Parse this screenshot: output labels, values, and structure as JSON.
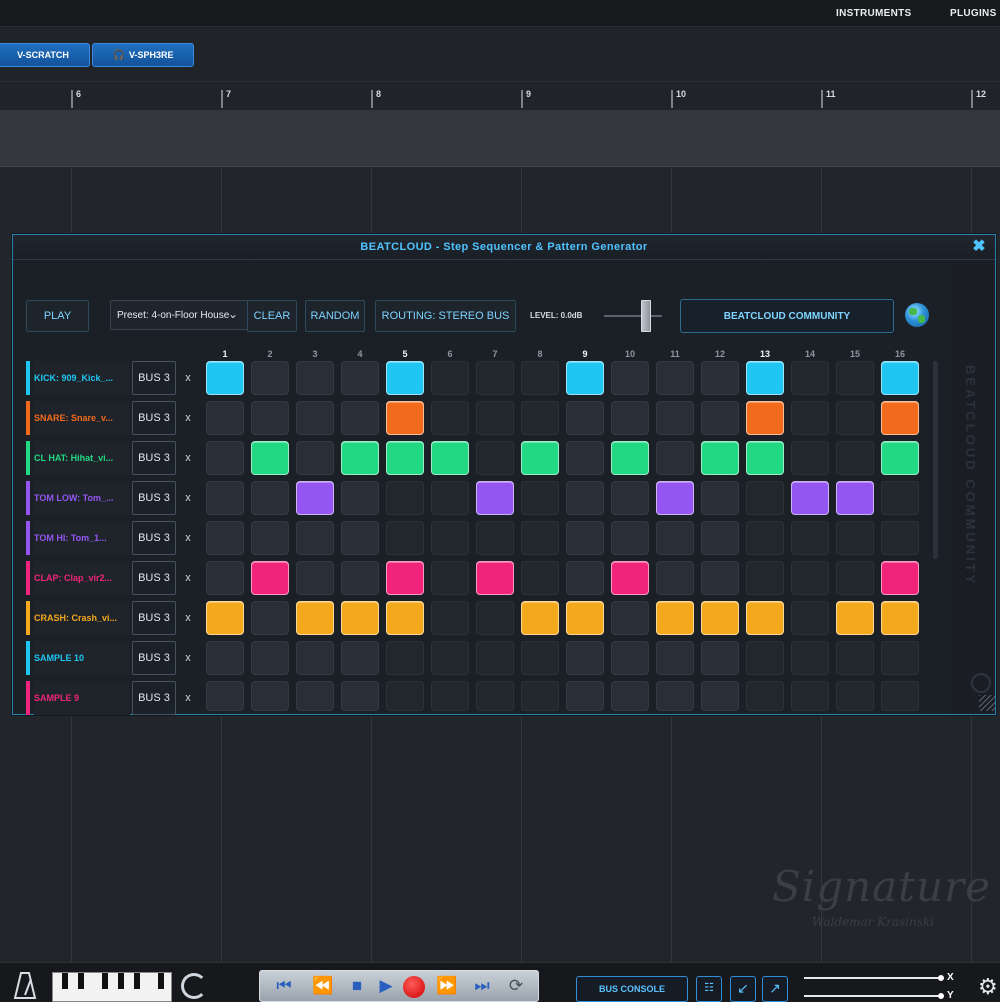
{
  "menu": {
    "instruments": "INSTRUMENTS",
    "plugins": "PLUGINS"
  },
  "tabs": [
    {
      "label": "V-SCRATCH"
    },
    {
      "label": "V-SPH3RE"
    }
  ],
  "ruler": {
    "marks": [
      "6",
      "7",
      "8",
      "9",
      "10",
      "11",
      "12"
    ]
  },
  "signature": {
    "main": "Signature",
    "sub": "Waldemar Krasinski"
  },
  "beatcloud": {
    "title": "BEATCLOUD - Step Sequencer & Pattern Generator",
    "side_label": "BEATCLOUD COMMUNITY",
    "toolbar": {
      "play": "PLAY",
      "preset": "Preset: 4-on-Floor House",
      "clear": "CLEAR",
      "random": "RANDOM",
      "routing": "ROUTING: STEREO BUS",
      "level": "LEVEL: 0.0dB",
      "community": "BEATCLOUD COMMUNITY"
    },
    "steps": [
      "1",
      "2",
      "3",
      "4",
      "5",
      "6",
      "7",
      "8",
      "9",
      "10",
      "11",
      "12",
      "13",
      "14",
      "15",
      "16"
    ],
    "tracks": [
      {
        "name": "KICK: 909_Kick_...",
        "bus": "BUS 3",
        "remove": "x",
        "color": "#1fc6f2",
        "pattern": [
          1,
          0,
          0,
          0,
          1,
          0,
          0,
          0,
          1,
          0,
          0,
          0,
          1,
          0,
          0,
          1
        ]
      },
      {
        "name": "SNARE: Snare_v...",
        "bus": "BUS 3",
        "remove": "x",
        "color": "#f26a1b",
        "pattern": [
          0,
          0,
          0,
          0,
          1,
          0,
          0,
          0,
          0,
          0,
          0,
          0,
          1,
          0,
          0,
          1
        ]
      },
      {
        "name": "CL HAT: Hihat_vi...",
        "bus": "BUS 3",
        "remove": "x",
        "color": "#22d883",
        "pattern": [
          0,
          1,
          0,
          1,
          1,
          1,
          0,
          1,
          0,
          1,
          0,
          1,
          1,
          0,
          0,
          1
        ]
      },
      {
        "name": "TOM LOW: Tom_...",
        "bus": "BUS 3",
        "remove": "x",
        "color": "#9356f0",
        "pattern": [
          0,
          0,
          1,
          0,
          0,
          0,
          1,
          0,
          0,
          0,
          1,
          0,
          0,
          1,
          1,
          0
        ]
      },
      {
        "name": "TOM HI: Tom_1...",
        "bus": "BUS 3",
        "remove": "x",
        "color": "#9356f0",
        "pattern": [
          0,
          0,
          0,
          0,
          0,
          0,
          0,
          0,
          0,
          0,
          0,
          0,
          0,
          0,
          0,
          0
        ]
      },
      {
        "name": "CLAP: Clap_vir2...",
        "bus": "BUS 3",
        "remove": "x",
        "color": "#f0247a",
        "pattern": [
          0,
          1,
          0,
          0,
          1,
          0,
          1,
          0,
          0,
          1,
          0,
          0,
          0,
          0,
          0,
          1
        ]
      },
      {
        "name": "CRASH: Crash_vi...",
        "bus": "BUS 3",
        "remove": "x",
        "color": "#f4a81c",
        "pattern": [
          1,
          0,
          1,
          1,
          1,
          0,
          0,
          1,
          1,
          0,
          1,
          1,
          1,
          0,
          1,
          1
        ]
      },
      {
        "name": "SAMPLE 10",
        "bus": "BUS 3",
        "remove": "x",
        "color": "#1fc6f2",
        "pattern": [
          0,
          0,
          0,
          0,
          0,
          0,
          0,
          0,
          0,
          0,
          0,
          0,
          0,
          0,
          0,
          0
        ]
      },
      {
        "name": "SAMPLE 9",
        "bus": "BUS 3",
        "remove": "x",
        "color": "#f0247a",
        "pattern": [
          0,
          0,
          0,
          0,
          0,
          0,
          0,
          0,
          0,
          0,
          0,
          0,
          0,
          0,
          0,
          0
        ]
      }
    ]
  },
  "bottom": {
    "bus_console": "BUS CONSOLE",
    "x_label": "X",
    "y_label": "Y"
  }
}
